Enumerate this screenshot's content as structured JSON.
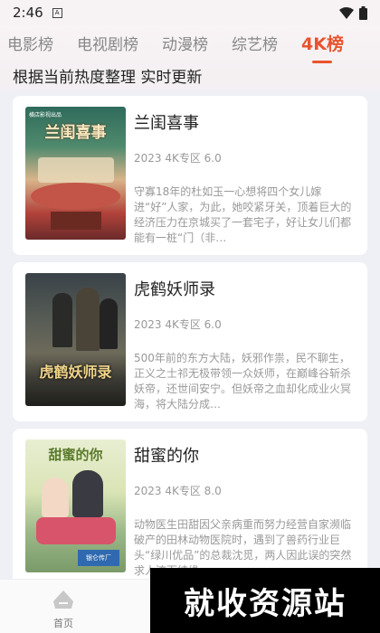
{
  "status_bar": {
    "time": "2:46",
    "notification_letter": "A"
  },
  "tabs": [
    {
      "label": "电影榜",
      "active": false
    },
    {
      "label": "电视剧榜",
      "active": false
    },
    {
      "label": "动漫榜",
      "active": false
    },
    {
      "label": "综艺榜",
      "active": false
    },
    {
      "label": "4K榜",
      "active": true
    }
  ],
  "subtitle": "根据当前热度整理 实时更新",
  "cards": [
    {
      "title": "兰闺喜事",
      "meta": "2023 4K专区 6.0",
      "description": "守寡18年的杜如玉一心想将四个女儿嫁进“好”人家，为此，她咬紧牙关，顶着巨大的经济压力在京城买了一套宅子，好让女儿们都能有一桩“门（非…",
      "poster_text": "兰闺喜事",
      "poster_badge": "横店影视出品"
    },
    {
      "title": "虎鹤妖师录",
      "meta": "2023 4K专区 6.0",
      "description": "500年前的东方大陆，妖邪作祟，民不聊生，正义之士祁无极带领一众妖师，在巅峰谷斩杀妖帝，还世间安宁。但妖帝之血却化成业火冥海，将大陆分成…",
      "poster_text": "虎鹤妖师录"
    },
    {
      "title": "甜蜜的你",
      "meta": "2023 4K专区 8.0",
      "description": "动物医生田甜因父亲病重而努力经营自家濒临破产的田林动物医院时，遇到了兽药行业巨头“绿川优品”的总裁沈觅，两人因此误的突然求人流而结缘…",
      "poster_text": "甜蜜的你",
      "poster_badge": "银仑传厂"
    }
  ],
  "bottom_nav": {
    "home_label": "首页"
  },
  "watermark": "就收资源站",
  "colors": {
    "accent": "#e8542e",
    "background": "#eef0f5"
  }
}
